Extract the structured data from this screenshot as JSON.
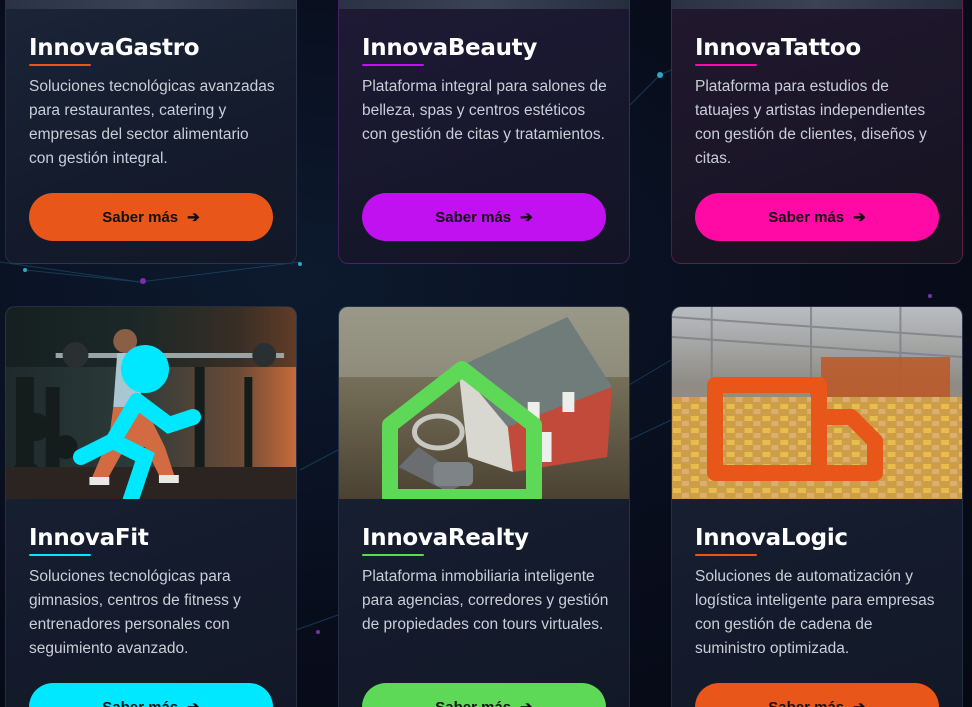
{
  "colors": {
    "gastro": "#e8561a",
    "beauty": "#c111f0",
    "tattoo": "#ff0aa5",
    "fit": "#00e8ff",
    "realty": "#5ed857",
    "logic": "#e8561a"
  },
  "cards": [
    {
      "title": "InnovaGastro",
      "description": "Soluciones tecnológicas avanzadas para restaurantes, catering y empresas del sector alimentario con gestión integral.",
      "button": "Saber más"
    },
    {
      "title": "InnovaBeauty",
      "description": "Plataforma integral para salones de belleza, spas y centros estéticos con gestión de citas y tratamientos.",
      "button": "Saber más"
    },
    {
      "title": "InnovaTattoo",
      "description": "Plataforma para estudios de tatuajes y artistas independientes con gestión de clientes, diseños y citas.",
      "button": "Saber más"
    },
    {
      "title": "InnovaFit",
      "description": "Soluciones tecnológicas para gimnasios, centros de fitness y entrenadores personales con seguimiento avanzado.",
      "button": "Saber más",
      "image": "gym-photo",
      "icon": "fitness-runner-icon"
    },
    {
      "title": "InnovaRealty",
      "description": "Plataforma inmobiliaria inteligente para agencias, corredores y gestión de propiedades con tours virtuales.",
      "button": "Saber más",
      "image": "house-model-photo",
      "icon": "home-icon"
    },
    {
      "title": "InnovaLogic",
      "description": "Soluciones de automatización y logística inteligente para empresas con gestión de cadena de suministro optimizada.",
      "button": "Saber más",
      "image": "warehouse-photo",
      "icon": "truck-icon"
    }
  ]
}
